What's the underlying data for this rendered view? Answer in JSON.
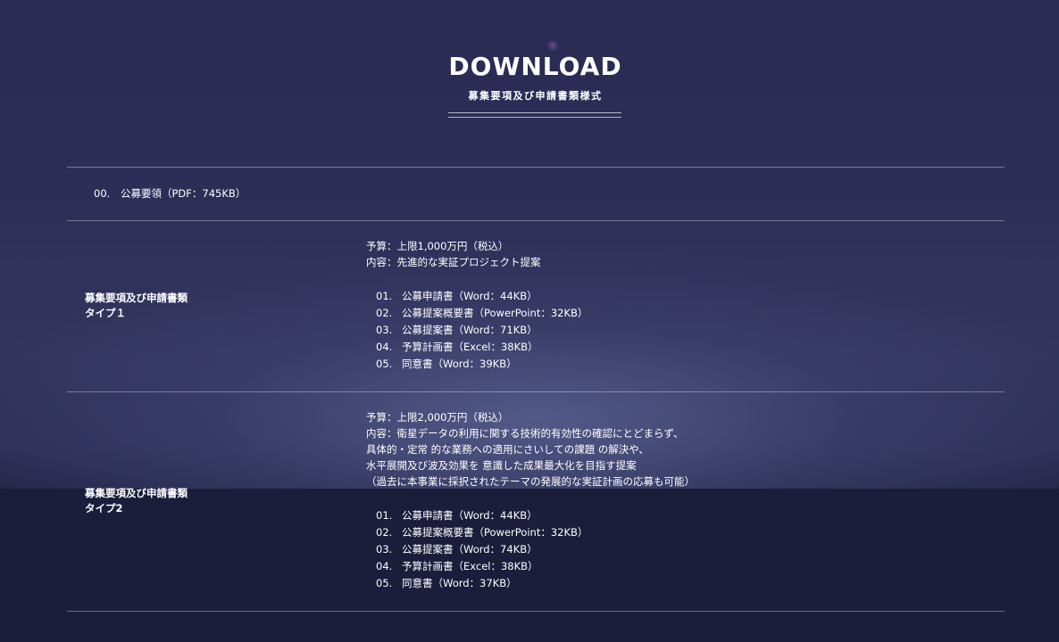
{
  "header": {
    "title": "DOWNLOAD",
    "subtitle": "募集要項及び申請書類様式"
  },
  "guidelines": {
    "number": "00.",
    "label": "公募要領（PDF：745KB）"
  },
  "types": [
    {
      "label_line1": "募集要項及び申請書類",
      "label_line2": "タイプ１",
      "budget": "予算：上限1,000万円（税込）",
      "content_lines": [
        "内容：先進的な実証プロジェクト提案"
      ],
      "files": [
        {
          "number": "01.",
          "label": "公募申請書（Word：44KB）"
        },
        {
          "number": "02.",
          "label": "公募提案概要書（PowerPoint：32KB）"
        },
        {
          "number": "03.",
          "label": "公募提案書（Word：71KB）"
        },
        {
          "number": "04.",
          "label": "予算計画書（Excel：38KB）"
        },
        {
          "number": "05.",
          "label": "同意書（Word：39KB）"
        }
      ]
    },
    {
      "label_line1": "募集要項及び申請書類",
      "label_line2": "タイプ2",
      "budget": "予算：上限2,000万円（税込）",
      "content_lines": [
        "内容：衛星データの利用に関する技術的有効性の確認にとどまらず、",
        "具体的・定常 的な業務への適用にさいしての課題 の解決や、",
        "水平展開及び波及効果を 意識した成果最大化を目指す提案",
        "（過去に本事業に採択されたテーマの発展的な実証計画の応募も可能）"
      ],
      "files": [
        {
          "number": "01.",
          "label": "公募申請書（Word：44KB）"
        },
        {
          "number": "02.",
          "label": "公募提案概要書（PowerPoint：32KB）"
        },
        {
          "number": "03.",
          "label": "公募提案書（Word：74KB）"
        },
        {
          "number": "04.",
          "label": "予算計画書（Excel：38KB）"
        },
        {
          "number": "05.",
          "label": "同意書（Word：37KB）"
        }
      ]
    }
  ]
}
